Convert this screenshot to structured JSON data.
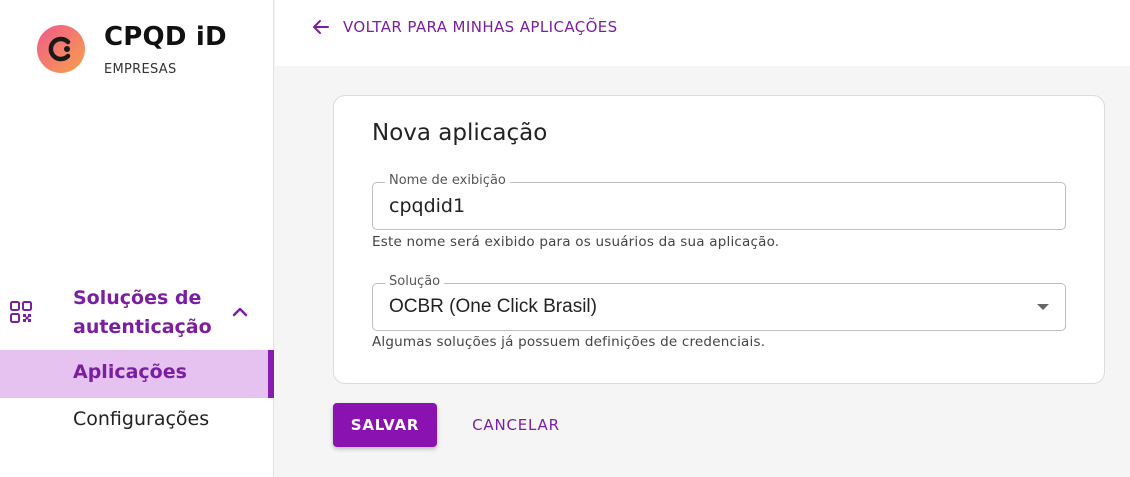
{
  "brand": {
    "name": "CPQD iD",
    "subtitle": "EMPRESAS",
    "logo_icon": "cpqd-logo-icon"
  },
  "sidebar": {
    "group": {
      "icon": "qr-code-icon",
      "label": "Soluções de autenticação",
      "expanded": true
    },
    "items": [
      {
        "label": "Aplicações",
        "active": true
      },
      {
        "label": "Configurações",
        "active": false
      }
    ]
  },
  "topbar": {
    "back_label": "VOLTAR PARA MINHAS APLICAÇÕES",
    "back_icon": "arrow-left-icon"
  },
  "form": {
    "title": "Nova aplicação",
    "display_name": {
      "label": "Nome de exibição",
      "value": "cpqdid1",
      "helper": "Este nome será exibido para os usuários da sua aplicação."
    },
    "solution": {
      "label": "Solução",
      "value": "OCBR (One Click Brasil)",
      "helper": "Algumas soluções já possuem definições de credenciais."
    }
  },
  "actions": {
    "save_label": "SALVAR",
    "cancel_label": "CANCELAR"
  },
  "colors": {
    "accent": "#7b1fa2",
    "button": "#8a12b0",
    "active_bg": "#e6c2f1"
  }
}
